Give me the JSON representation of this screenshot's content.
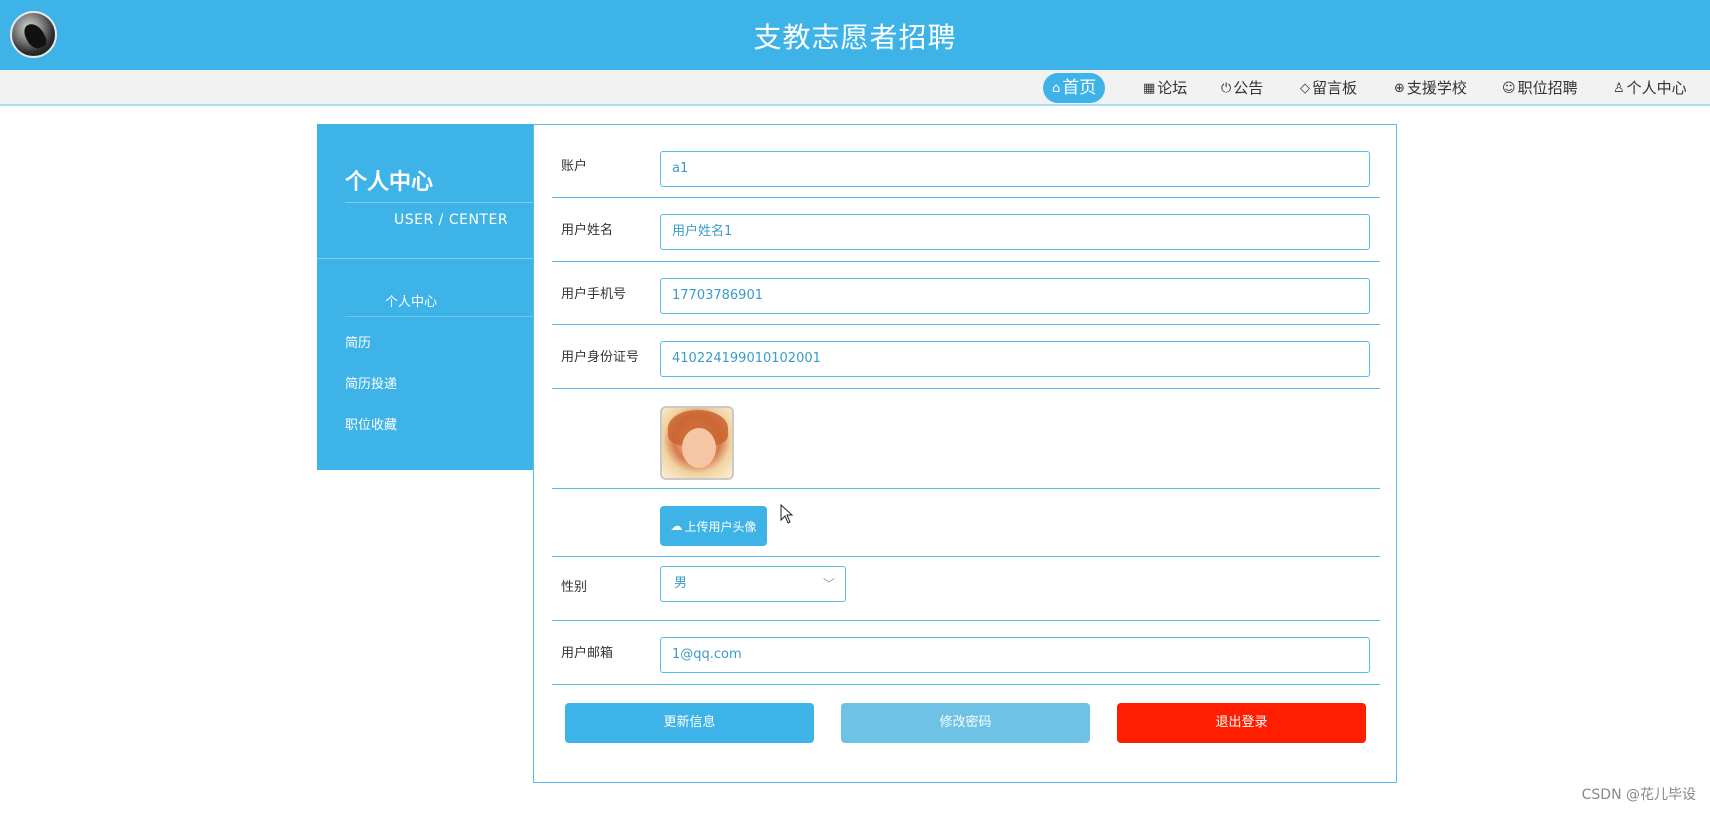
{
  "header": {
    "title": "支教志愿者招聘"
  },
  "nav": [
    {
      "icon": "⌂",
      "label": "首页",
      "active": true
    },
    {
      "icon": "▦",
      "label": "论坛"
    },
    {
      "icon": "⏻",
      "label": "公告"
    },
    {
      "icon": "◇",
      "label": "留言板"
    },
    {
      "icon": "⊕",
      "label": "支援学校"
    },
    {
      "icon": "☺",
      "label": "职位招聘"
    },
    {
      "icon": "♙",
      "label": "个人中心"
    }
  ],
  "sidebar": {
    "title": "个人中心",
    "subtitle": "USER / CENTER",
    "items": [
      "个人中心",
      "简历",
      "简历投递",
      "职位收藏"
    ]
  },
  "form": {
    "account": {
      "label": "账户",
      "value": "a1"
    },
    "name": {
      "label": "用户姓名",
      "value": "用户姓名1"
    },
    "phone": {
      "label": "用户手机号",
      "value": "17703786901"
    },
    "idcard": {
      "label": "用户身份证号",
      "value": "410224199010102001"
    },
    "upload_label": "上传用户头像",
    "gender": {
      "label": "性别",
      "value": "男"
    },
    "email": {
      "label": "用户邮箱",
      "value": "1@qq.com"
    }
  },
  "buttons": {
    "update": "更新信息",
    "change_password": "修改密码",
    "logout": "退出登录"
  },
  "watermark": "CSDN @花儿毕设",
  "colors": {
    "primary": "#3db3e8",
    "secondary": "#6dc2e6",
    "danger": "#ff1e00"
  }
}
